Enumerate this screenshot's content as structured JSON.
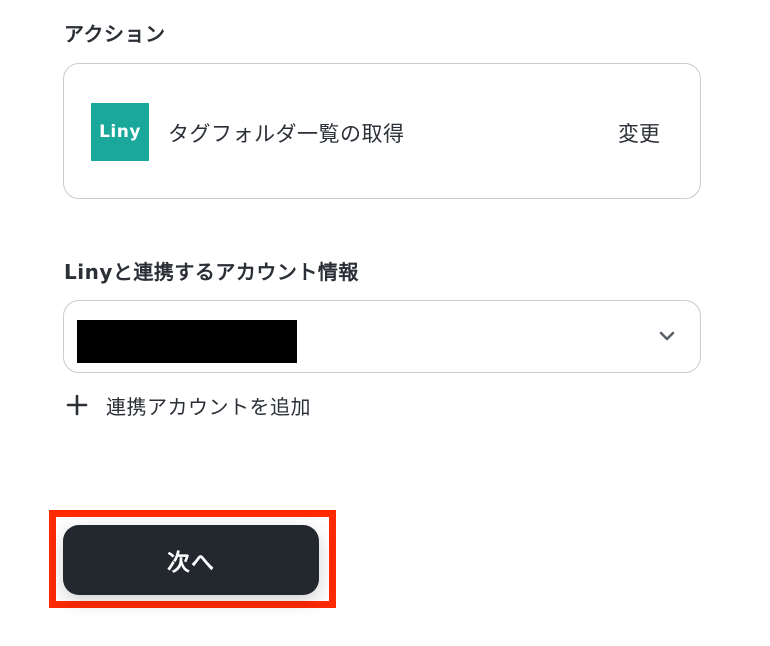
{
  "action_section": {
    "label": "アクション",
    "app_logo_text": "Liny",
    "action_name": "タグフォルダ一覧の取得",
    "change_label": "変更"
  },
  "account_section": {
    "label": "Linyと連携するアカウント情報",
    "selected_value": "",
    "chevron_icon": "chevron-down-icon"
  },
  "add_account": {
    "icon": "plus-icon",
    "label": "連携アカウントを追加"
  },
  "next_button": {
    "label": "次へ"
  },
  "colors": {
    "brand_liny": "#1aa89b",
    "button_dark": "#23272e",
    "highlight": "#ff2a00",
    "border": "#c9ccd1"
  }
}
